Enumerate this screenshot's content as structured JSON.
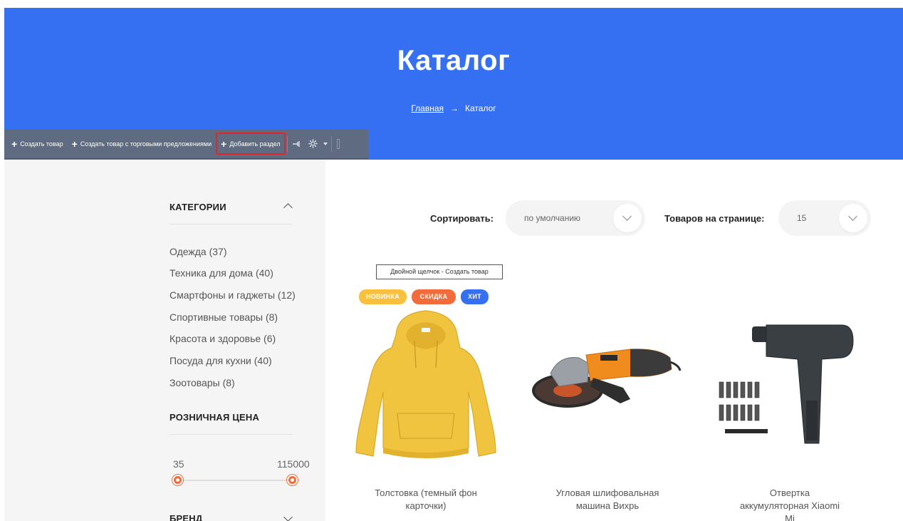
{
  "hero": {
    "title": "Каталог",
    "breadcrumb": [
      {
        "label": "Главная"
      },
      {
        "label": "Каталог"
      }
    ],
    "separator": "→",
    "background_color": "#356ff2"
  },
  "toolbar": {
    "create_product": "Создать товар",
    "create_product_offers": "Создать товар с торговыми предложениями",
    "add_section": "Добавить раздел",
    "icons": [
      "pin-icon",
      "gear-icon",
      "dropdown-icon",
      "drag-handle-icon"
    ]
  },
  "filters": {
    "categories": {
      "title": "КАТЕГОРИИ",
      "expanded": true,
      "items": [
        "Одежда (37)",
        "Техника для дома (40)",
        "Смартфоны и гаджеты (12)",
        "Спортивные товары (8)",
        "Красота и здоровье (6)",
        "Посуда для кухни (40)",
        "Зоотовары (8)"
      ]
    },
    "price": {
      "title": "РОЗНИЧНАЯ ЦЕНА",
      "min": "35",
      "max": "115000",
      "accent_color": "#f26b3a"
    },
    "brand": {
      "title": "БРЕНД",
      "expanded": false
    }
  },
  "sort": {
    "label": "Сортировать:",
    "value": "по умолчанию",
    "per_page_label": "Товаров на странице:",
    "per_page_value": "15"
  },
  "tooltip": "Двойной щелчок - Создать товар",
  "badges": [
    {
      "label": "НОВИНКА",
      "color": "#f9c03e"
    },
    {
      "label": "СКИДКА",
      "color": "#f26b3a"
    },
    {
      "label": "ХИТ",
      "color": "#356ff2"
    }
  ],
  "products": [
    {
      "name_line1": "Толстовка (темный фон",
      "name_line2": "карточки)",
      "image": "yellow-hoodie"
    },
    {
      "name_line1": "Угловая шлифовальная",
      "name_line2": "машина Вихрь",
      "image": "angle-grinder"
    },
    {
      "name_line1": "Отвертка",
      "name_line2": "аккумуляторная Xiaomi",
      "name_line3": "Mi",
      "image": "cordless-screwdriver"
    }
  ]
}
